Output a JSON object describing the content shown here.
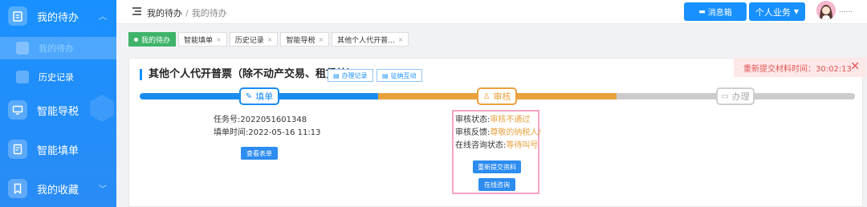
{
  "sidebar": {
    "groups": [
      {
        "label": "我的待办",
        "icon": "clipboard-icon"
      },
      {
        "label": "智能导税",
        "icon": "monitor-icon"
      },
      {
        "label": "智能填单",
        "icon": "form-icon"
      },
      {
        "label": "我的收藏",
        "icon": "bookmark-icon"
      }
    ],
    "sub_items": [
      {
        "label": "我的待办",
        "active": true
      },
      {
        "label": "历史记录",
        "active": false
      }
    ]
  },
  "header": {
    "breadcrumb": [
      "我的待办",
      "我的待办"
    ],
    "message_button": "消息箱",
    "business_button": "个人业务",
    "user_name": "......"
  },
  "tags": [
    {
      "label": "我的待办",
      "active": true
    },
    {
      "label": "智能填单",
      "active": false
    },
    {
      "label": "历史记录",
      "active": false
    },
    {
      "label": "智能导税",
      "active": false
    },
    {
      "label": "其他个人代开普...",
      "active": false
    }
  ],
  "card": {
    "title": "其他个人代开普票（除不动产交易、租赁外）",
    "record_button": "办理记录",
    "interaction_button": "征纳互动",
    "resubmit_timer": "重新提交材料时间：30:02:13",
    "steps": [
      "填单",
      "审核",
      "办理"
    ],
    "task_no_label": "任务号:",
    "task_no": "2022051601348",
    "fill_time_label": "填单时间:",
    "fill_time": "2022-05-16 11:13",
    "view_form_button": "查看表单",
    "review_status_label": "审核状态:",
    "review_status": "审核不通过",
    "review_feedback_label": "审核反馈:",
    "review_feedback": "尊敬的纳税人/",
    "consult_status_label": "在线咨询状态:",
    "consult_status": "等待叫号",
    "resubmit_button": "重新提交资料",
    "consult_button": "在线咨询"
  },
  "colors": {
    "primary": "#1890ff",
    "review": "#e9a13d",
    "pending": "#cccccc",
    "alert": "#e35656",
    "tag_active": "#3fb36a"
  }
}
